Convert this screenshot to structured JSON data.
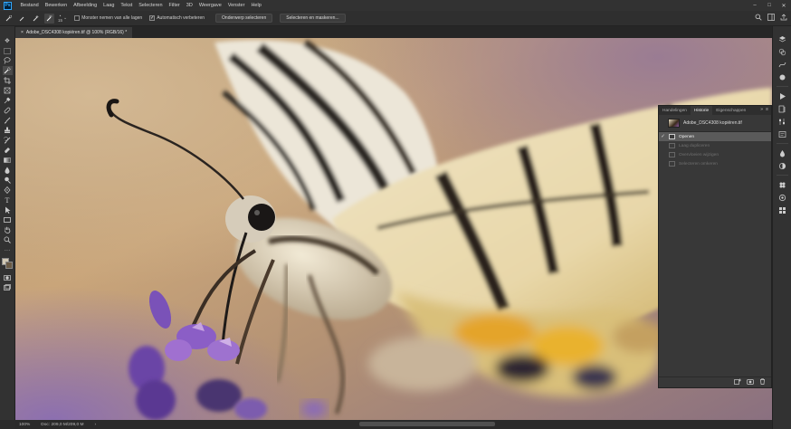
{
  "app": {
    "logo": "Ps"
  },
  "menu": [
    "Bestand",
    "Bewerken",
    "Afbeelding",
    "Laag",
    "Tekst",
    "Selecteren",
    "Filter",
    "3D",
    "Weergave",
    "Venster",
    "Help"
  ],
  "window_controls": [
    "–",
    "□",
    "✕"
  ],
  "options": {
    "brush_size": "15",
    "sample_all_layers": "Monster nemen van alle lagen",
    "auto_enhance": "Automatisch verbeteren",
    "subject_button": "Onderwerp selecteren",
    "select_mask_button": "Selecteren en maskeren..."
  },
  "document": {
    "tab_title": "Adobe_DSC4308 kopiëren.tif @ 100% (RGB/16) *",
    "close": "×"
  },
  "history_panel": {
    "tabs": [
      "Handelingen",
      "Historie",
      "Eigenschappen"
    ],
    "active_tab": "Historie",
    "collapse": "»",
    "menu": "≡",
    "snapshot_label": "Adobe_DSC4308 kopiëren.tif",
    "states": [
      {
        "label": "Openen",
        "current": true
      },
      {
        "label": "Laag dupliceren",
        "current": false
      },
      {
        "label": "Overvloeien wijzigen",
        "current": false
      },
      {
        "label": "Selecteren omkeren",
        "current": false
      }
    ]
  },
  "status": {
    "zoom": "100%",
    "doc_info": "Doc: 209,0 M/209,0 M",
    "arrow": "›"
  }
}
